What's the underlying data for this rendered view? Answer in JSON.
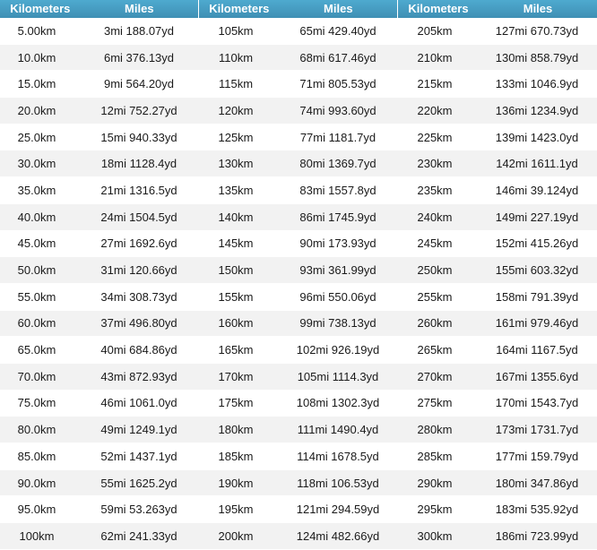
{
  "headers": {
    "km": "Kilometers",
    "mi": "Miles"
  },
  "columns": [
    {
      "rows": [
        {
          "km": "5.00km",
          "mi": "3mi 188.07yd"
        },
        {
          "km": "10.0km",
          "mi": "6mi 376.13yd"
        },
        {
          "km": "15.0km",
          "mi": "9mi 564.20yd"
        },
        {
          "km": "20.0km",
          "mi": "12mi 752.27yd"
        },
        {
          "km": "25.0km",
          "mi": "15mi 940.33yd"
        },
        {
          "km": "30.0km",
          "mi": "18mi 1128.4yd"
        },
        {
          "km": "35.0km",
          "mi": "21mi 1316.5yd"
        },
        {
          "km": "40.0km",
          "mi": "24mi 1504.5yd"
        },
        {
          "km": "45.0km",
          "mi": "27mi 1692.6yd"
        },
        {
          "km": "50.0km",
          "mi": "31mi 120.66yd"
        },
        {
          "km": "55.0km",
          "mi": "34mi 308.73yd"
        },
        {
          "km": "60.0km",
          "mi": "37mi 496.80yd"
        },
        {
          "km": "65.0km",
          "mi": "40mi 684.86yd"
        },
        {
          "km": "70.0km",
          "mi": "43mi 872.93yd"
        },
        {
          "km": "75.0km",
          "mi": "46mi 1061.0yd"
        },
        {
          "km": "80.0km",
          "mi": "49mi 1249.1yd"
        },
        {
          "km": "85.0km",
          "mi": "52mi 1437.1yd"
        },
        {
          "km": "90.0km",
          "mi": "55mi 1625.2yd"
        },
        {
          "km": "95.0km",
          "mi": "59mi 53.263yd"
        },
        {
          "km": "100km",
          "mi": "62mi 241.33yd"
        }
      ]
    },
    {
      "rows": [
        {
          "km": "105km",
          "mi": "65mi 429.40yd"
        },
        {
          "km": "110km",
          "mi": "68mi 617.46yd"
        },
        {
          "km": "115km",
          "mi": "71mi 805.53yd"
        },
        {
          "km": "120km",
          "mi": "74mi 993.60yd"
        },
        {
          "km": "125km",
          "mi": "77mi 1181.7yd"
        },
        {
          "km": "130km",
          "mi": "80mi 1369.7yd"
        },
        {
          "km": "135km",
          "mi": "83mi 1557.8yd"
        },
        {
          "km": "140km",
          "mi": "86mi 1745.9yd"
        },
        {
          "km": "145km",
          "mi": "90mi 173.93yd"
        },
        {
          "km": "150km",
          "mi": "93mi 361.99yd"
        },
        {
          "km": "155km",
          "mi": "96mi 550.06yd"
        },
        {
          "km": "160km",
          "mi": "99mi 738.13yd"
        },
        {
          "km": "165km",
          "mi": "102mi 926.19yd"
        },
        {
          "km": "170km",
          "mi": "105mi 1114.3yd"
        },
        {
          "km": "175km",
          "mi": "108mi 1302.3yd"
        },
        {
          "km": "180km",
          "mi": "111mi 1490.4yd"
        },
        {
          "km": "185km",
          "mi": "114mi 1678.5yd"
        },
        {
          "km": "190km",
          "mi": "118mi 106.53yd"
        },
        {
          "km": "195km",
          "mi": "121mi 294.59yd"
        },
        {
          "km": "200km",
          "mi": "124mi 482.66yd"
        }
      ]
    },
    {
      "rows": [
        {
          "km": "205km",
          "mi": "127mi 670.73yd"
        },
        {
          "km": "210km",
          "mi": "130mi 858.79yd"
        },
        {
          "km": "215km",
          "mi": "133mi 1046.9yd"
        },
        {
          "km": "220km",
          "mi": "136mi 1234.9yd"
        },
        {
          "km": "225km",
          "mi": "139mi 1423.0yd"
        },
        {
          "km": "230km",
          "mi": "142mi 1611.1yd"
        },
        {
          "km": "235km",
          "mi": "146mi 39.124yd"
        },
        {
          "km": "240km",
          "mi": "149mi 227.19yd"
        },
        {
          "km": "245km",
          "mi": "152mi 415.26yd"
        },
        {
          "km": "250km",
          "mi": "155mi 603.32yd"
        },
        {
          "km": "255km",
          "mi": "158mi 791.39yd"
        },
        {
          "km": "260km",
          "mi": "161mi 979.46yd"
        },
        {
          "km": "265km",
          "mi": "164mi 1167.5yd"
        },
        {
          "km": "270km",
          "mi": "167mi 1355.6yd"
        },
        {
          "km": "275km",
          "mi": "170mi 1543.7yd"
        },
        {
          "km": "280km",
          "mi": "173mi 1731.7yd"
        },
        {
          "km": "285km",
          "mi": "177mi 159.79yd"
        },
        {
          "km": "290km",
          "mi": "180mi 347.86yd"
        },
        {
          "km": "295km",
          "mi": "183mi 535.92yd"
        },
        {
          "km": "300km",
          "mi": "186mi 723.99yd"
        }
      ]
    }
  ],
  "colors": {
    "header_bg": "#4aa0c4",
    "header_text": "#ffffff",
    "row_alt": "#f2f2f2",
    "text": "#1a1a1a"
  }
}
